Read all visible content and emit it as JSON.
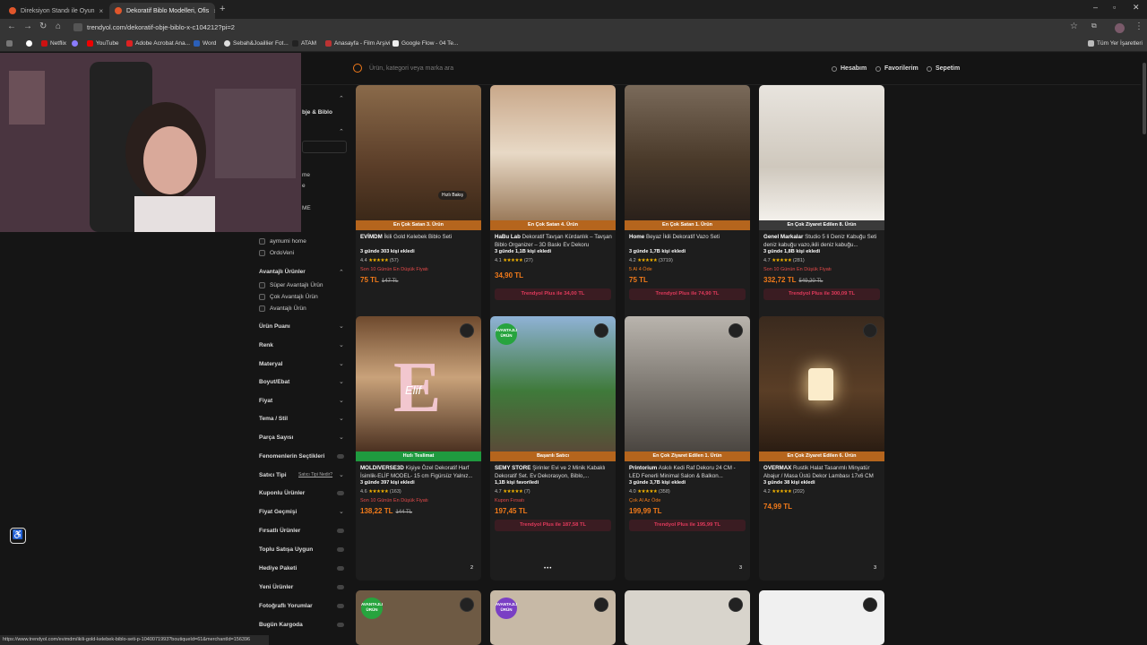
{
  "browser": {
    "tabs": [
      {
        "label": "Direksiyon Standı ile Oyun"
      },
      {
        "label": "Dekoratif Biblo Modelleri, Ofis"
      }
    ],
    "url": "trendyol.com/dekoratif-obje-biblo-x-c104212?pi=2",
    "bookmarks": [
      "Netflix",
      "YouTube",
      "Adobe Acrobat Ana...",
      "Word",
      "Sebah&Joaillier Fot...",
      "ATAM",
      "Anasayfa - Film Arşivi",
      "Google Flow - 04 Te..."
    ],
    "all_bookmarks": "Tüm Yer İşaretleri",
    "status_url": "https://www.trendyol.com/evimdm/ikili-gold-kelebek-biblo-seti-p-1040071993?boutiqueId=61&merchantId=156396"
  },
  "header": {
    "search_placeholder": "Ürün, kategori veya marka ara",
    "account": "Hesabım",
    "favorites": "Favorilerim",
    "cart": "Sepetim"
  },
  "sidebar": {
    "partial": [
      "bje & Biblo",
      "me",
      "e",
      "ME"
    ],
    "brands": [
      "aymumi home",
      "OrdoVeni"
    ],
    "advantaged_title": "Avantajlı Ürünler",
    "advantaged": [
      "Süper Avantajlı Ürün",
      "Çok Avantajlı Ürün",
      "Avantajlı Ürün"
    ],
    "filters": [
      "Ürün Puanı",
      "Renk",
      "Materyal",
      "Boyut/Ebat",
      "Fiyat",
      "Tema / Stil",
      "Parça Sayısı",
      "Fenomenlerin Seçtikleri",
      "Satıcı Tipi",
      "Kuponlu Ürünler",
      "Fiyat Geçmişi",
      "Fırsatlı Ürünler",
      "Toplu Satışa Uygun",
      "Hediye Paketi",
      "Yeni Ürünler",
      "Fotoğraflı Yorumlar",
      "Bugün Kargoda"
    ],
    "seller_type_link": "Satıcı Tipi Nedir?"
  },
  "cards": [
    {
      "badge": "En Çok Satan 3. Ürün",
      "title_brand": "EVİMDM",
      "title": "İkili Gold Kelebek Biblo Seti",
      "added": "3 günde 303 kişi ekledi",
      "rating": "4.4",
      "reviews": "(57)",
      "extra": "Son 10 Günün En Düşük Fiyatı",
      "price": "75 TL",
      "old": "147 TL",
      "plus": "",
      "quick": "Hızlı Bakış",
      "count": "2"
    },
    {
      "badge": "En Çok Satan 4. Ürün",
      "title_brand": "HaBu Lab",
      "title": "Dekoratif Tavşan Kürdanlık – Tavşan Biblo Organizer – 3D Baskı Ev Dekoru",
      "added": "3 günde 1,1B kişi ekledi",
      "rating": "4.1",
      "reviews": "(27)",
      "extra": "",
      "price": "34,90 TL",
      "old": "",
      "plus": "Trendyol Plus ile 34,00 TL"
    },
    {
      "badge": "En Çok Satan 1. Ürün",
      "title_brand": "Home",
      "title": "Beyaz İkili Dekoratif Vazo Seti",
      "added": "3 günde 1,7B kişi ekledi",
      "rating": "4.2",
      "reviews": "(3719)",
      "extra": "5 Al 4 Öde",
      "price": "75 TL",
      "old": "",
      "plus": "Trendyol Plus ile 74,90 TL"
    },
    {
      "badge": "En Çok Ziyaret Edilen 8. Ürün",
      "title_brand": "Genel Markalar",
      "title": "Studio 5 li Deniz Kabuğu Seti deniz kabuğu vazo,ikili deniz kabuğu...",
      "added": "3 günde 1,8B kişi ekledi",
      "rating": "4.7",
      "reviews": "(281)",
      "extra": "Son 10 Günün En Düşük Fiyatı",
      "price": "332,72 TL",
      "old": "549,20 TL",
      "plus": "Trendyol Plus ile 300,09 TL"
    },
    {
      "badge": "Hızlı Teslimat",
      "title_brand": "MOLDIVERSE3D",
      "title": "Kişiye Özel Dekoratif Harf İsimlik-ELİF MODEL- 15 cm Figürsüz Yalnız...",
      "added": "3 günde 397 kişi ekledi",
      "rating": "4.6",
      "reviews": "(163)",
      "extra": "Son 10 Günün En Düşük Fiyatı",
      "price": "138,22 TL",
      "old": "144 TL",
      "plus": "",
      "count": "2",
      "letter": "E",
      "name": "Elif"
    },
    {
      "badge": "Başarılı Satıcı",
      "title_brand": "SEMY STORE",
      "title": "Şirinler Evi ve 2 Minik Kabaklı Dekoratif Set. Ev Dekorasyon, Biblo,...",
      "added": "1,1B kişi favoriledi",
      "rating": "4.7",
      "reviews": "(7)",
      "extra": "Kupon Fırsatı",
      "price": "197,45 TL",
      "old": "",
      "plus": "Trendyol Plus ile 187,58 TL",
      "av": "AVANTAJLI ÜRÜN"
    },
    {
      "badge": "En Çok Ziyaret Edilen 1. Ürün",
      "title_brand": "Printorium",
      "title": "Askılı Kedi Raf Dekoru 24 CM - LED Fenerli Minimal Salon & Balkon...",
      "added": "3 günde 3,7B kişi ekledi",
      "rating": "4.0",
      "reviews": "(358)",
      "extra": "Çok Al Az Öde",
      "price": "199,99 TL",
      "old": "",
      "plus": "Trendyol Plus ile 195,99 TL",
      "count": "3"
    },
    {
      "badge": "En Çok Ziyaret Edilen 6. Ürün",
      "title_brand": "OVERMAX",
      "title": "Rustik Halat Tasarımlı Minyatür Abajur / Masa Üstü Dekor Lambası 17x6 CM",
      "added": "3 günde 38 kişi ekledi",
      "rating": "4.2",
      "reviews": "(202)",
      "extra": "",
      "price": "74,99 TL",
      "old": "",
      "plus": "",
      "count": "3"
    }
  ],
  "bottom_badges": [
    "AVANTAJLI ÜRÜN",
    "AVANTAJLI ÜRÜN"
  ],
  "colors": {
    "accent": "#f27a1a",
    "plus": "#e23a5c",
    "badge": "#c25a12",
    "green": "#27a43e"
  }
}
